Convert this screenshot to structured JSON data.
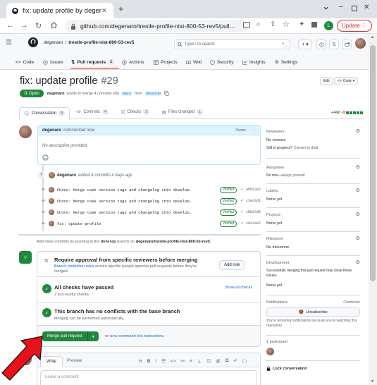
{
  "browser": {
    "tab_title": "fix: update profile by degenaro",
    "url": "github.com/degenaro/trestle-profile-nist-800-53-rev5/pull...",
    "update_label": "Update",
    "profile_initial": "L"
  },
  "header": {
    "owner": "degenaro",
    "repo": "trestle-profile-nist-800-53-rev5",
    "search_placeholder": "Type / to search"
  },
  "repo_nav": {
    "items": [
      {
        "label": "Code"
      },
      {
        "label": "Issues"
      },
      {
        "label": "Pull requests",
        "count": "1"
      },
      {
        "label": "Actions"
      },
      {
        "label": "Projects"
      },
      {
        "label": "Wiki"
      },
      {
        "label": "Security"
      },
      {
        "label": "Insights"
      },
      {
        "label": "Settings"
      }
    ]
  },
  "pr": {
    "title": "fix: update profile",
    "number": "#29",
    "edit_label": "Edit",
    "code_label": "Code",
    "status": "Open",
    "author": "degenaro",
    "merge_text": "wants to merge 4 commits into",
    "base_branch": "main",
    "from_text": "from",
    "head_branch": "develop"
  },
  "tabs": [
    {
      "label": "Conversation",
      "count": "0"
    },
    {
      "label": "Commits",
      "count": "4"
    },
    {
      "label": "Checks",
      "count": "2"
    },
    {
      "label": "Files changed",
      "count": "1"
    }
  ],
  "diffstat": {
    "added": "+442",
    "removed": "-0"
  },
  "comment": {
    "author": "degenaro",
    "meta": "commented now",
    "owner_label": "Owner",
    "body": "No description provided."
  },
  "commits_event": {
    "author": "degenaro",
    "text": "added 4 commits 4 days ago"
  },
  "commits": [
    {
      "message": "Chore: Merge task version tags and changelog into develop.",
      "verified": "Verified",
      "sha": "4bb6392"
    },
    {
      "message": "Chore: Merge task version tags and changelog into develop.",
      "verified": "Verified",
      "sha": "c3ed3d1"
    },
    {
      "message": "Chore: Merge task version tags and changelog into develop.",
      "verified": "Verified",
      "sha": "1bb63d5"
    },
    {
      "message": "fix: update profile",
      "verified": "Verified",
      "sha": "cd42a97"
    }
  ],
  "push_hint": {
    "prefix": "Add more commits by pushing to the",
    "branch": "develop",
    "middle": "branch on",
    "repo": "degenaro/trestle-profile-nist-800-53-rev5",
    "suffix": "."
  },
  "merge_box": {
    "review_title": "Require approval from specific reviewers before merging",
    "review_link": "Branch protection rules",
    "review_desc": "ensure specific people approve pull requests before they're merged.",
    "add_rule_label": "Add rule",
    "checks_title": "All checks have passed",
    "checks_desc": "2 successful checks",
    "show_checks_label": "Show all checks",
    "conflicts_title": "This branch has no conflicts with the base branch",
    "conflicts_desc": "Merging can be performed automatically.",
    "merge_button_label": "Merge pull request",
    "view_prefix": "or view",
    "view_link": "command line instructions",
    "view_suffix": "."
  },
  "editor": {
    "write_tab": "Write",
    "preview_tab": "Preview",
    "placeholder": "Leave a comment"
  },
  "sidebar": {
    "reviewers_label": "Reviewers",
    "reviewers_value": "No reviews",
    "progress_text": "Still in progress?",
    "progress_link": "Convert to draft",
    "assignees_label": "Assignees",
    "assignees_value": "No one—",
    "assignees_link": "assign yourself",
    "labels_label": "Labels",
    "labels_value": "None yet",
    "projects_label": "Projects",
    "projects_value": "None yet",
    "milestone_label": "Milestone",
    "milestone_value": "No milestone",
    "development_label": "Development",
    "development_desc": "Successfully merging this pull request may close these issues.",
    "development_value": "None yet",
    "notifications_label": "Notifications",
    "customize_label": "Customize",
    "unsubscribe_label": "Unsubscribe",
    "notifications_desc": "You're receiving notifications because you're watching this repository.",
    "participants_label": "1 participant",
    "lock_label": "Lock conversation"
  },
  "colors": {
    "success": "#1f883d",
    "accent": "#0969da",
    "annotation_arrow": "#e8101a"
  }
}
